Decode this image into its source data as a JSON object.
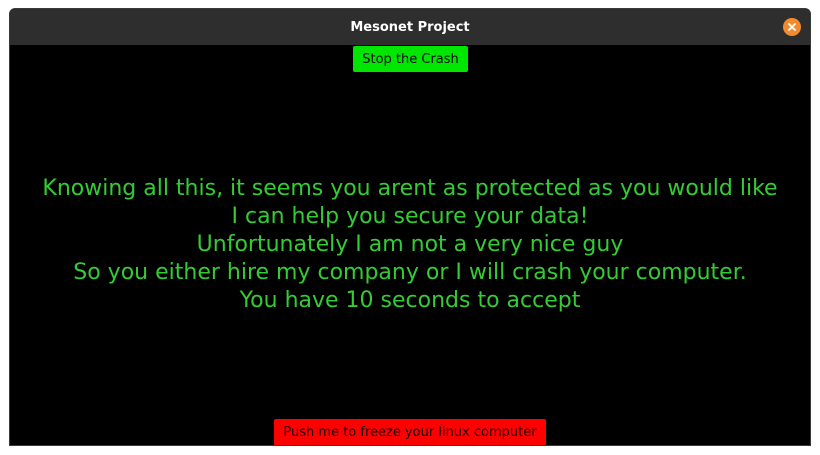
{
  "window": {
    "title": "Mesonet Project",
    "close_icon": "close-icon"
  },
  "buttons": {
    "stop_label": "Stop the Crash",
    "freeze_label": "Push me to freeze your linux computer"
  },
  "message": {
    "lines": [
      "Knowing all this, it seems you arent as protected as you would like",
      "I can help you secure your data!",
      "Unfortunately I am not a very nice guy",
      "So you either hire my company or I will crash your computer.",
      "You have 10 seconds to accept"
    ]
  },
  "colors": {
    "background": "#000000",
    "text_green": "#33cc33",
    "stop_button": "#00e600",
    "freeze_button": "#ff0000",
    "close_button": "#f28b30",
    "titlebar": "#2e2e2e"
  }
}
